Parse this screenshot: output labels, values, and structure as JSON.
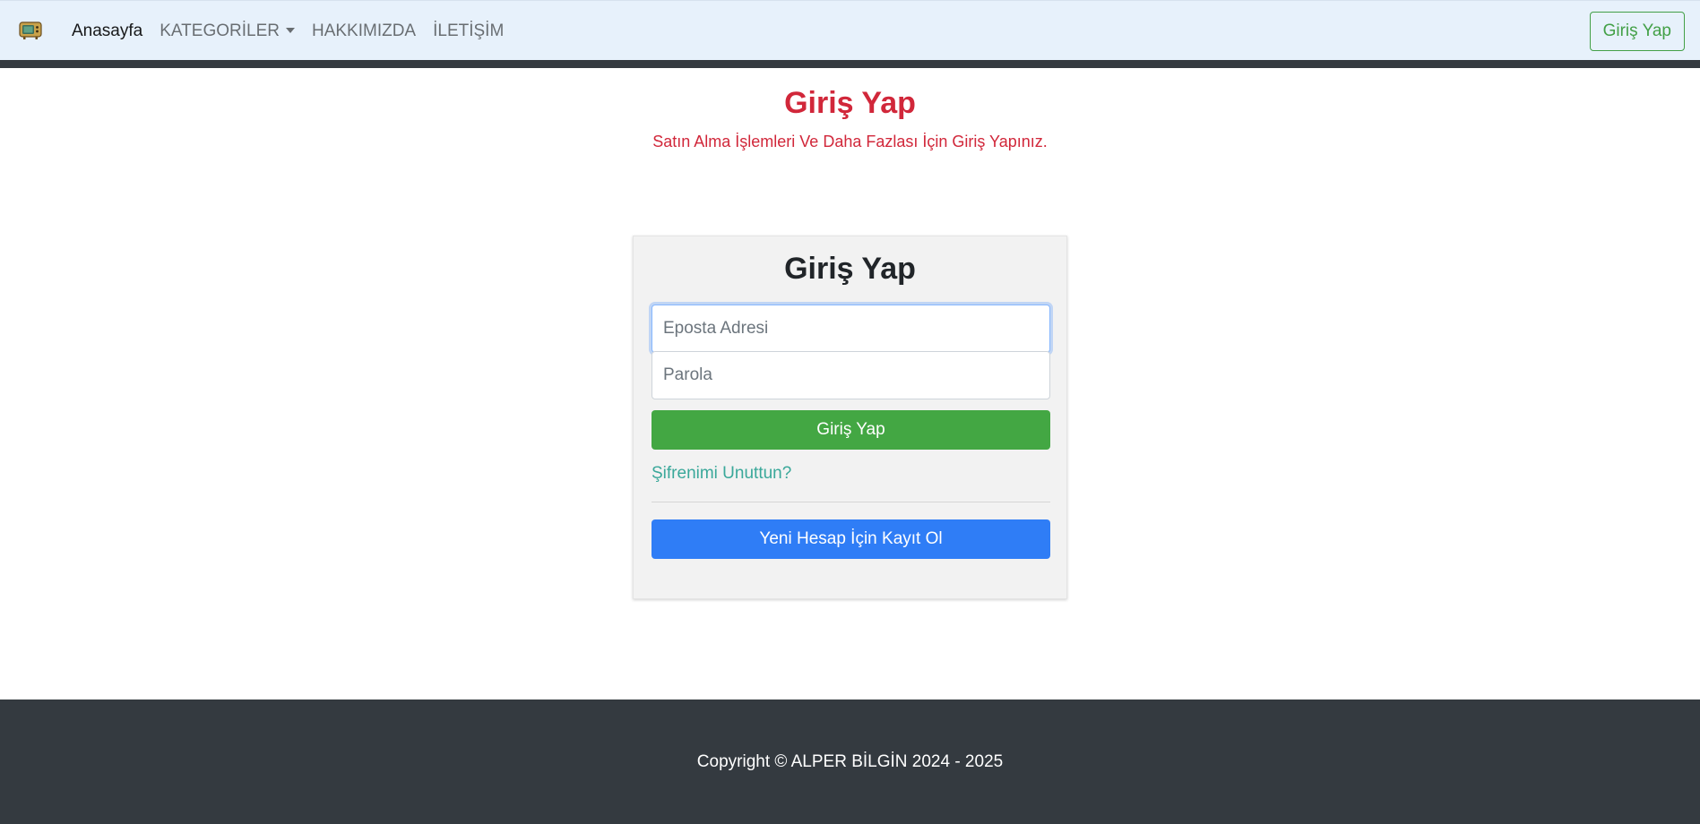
{
  "navbar": {
    "brand_icon": "retro-tv-icon",
    "links": [
      {
        "label": "Anasayfa",
        "active": true
      },
      {
        "label": "KATEGORİLER",
        "dropdown": true
      },
      {
        "label": "HAKKIMIZDA"
      },
      {
        "label": "İLETİŞİM"
      }
    ],
    "login_button": "Giriş Yap"
  },
  "hero": {
    "title": "Giriş Yap",
    "subtitle": "Satın Alma İşlemleri Ve Daha Fazlası İçin Giriş Yapınız."
  },
  "login_card": {
    "title": "Giriş Yap",
    "email": {
      "placeholder": "Eposta Adresi",
      "value": ""
    },
    "password": {
      "placeholder": "Parola",
      "value": ""
    },
    "submit_label": "Giriş Yap",
    "forgot_label": "Şifrenimi Unuttun?",
    "register_label": "Yeni Hesap İçin Kayıt Ol"
  },
  "footer": {
    "copyright": "Copyright © ALPER BİLGİN 2024 - 2025"
  },
  "colors": {
    "navbar_bg": "#e7f1fb",
    "accent_red": "#d1273a",
    "green": "#43a743",
    "blue": "#2f7df6",
    "footer_bg": "#343a40"
  }
}
